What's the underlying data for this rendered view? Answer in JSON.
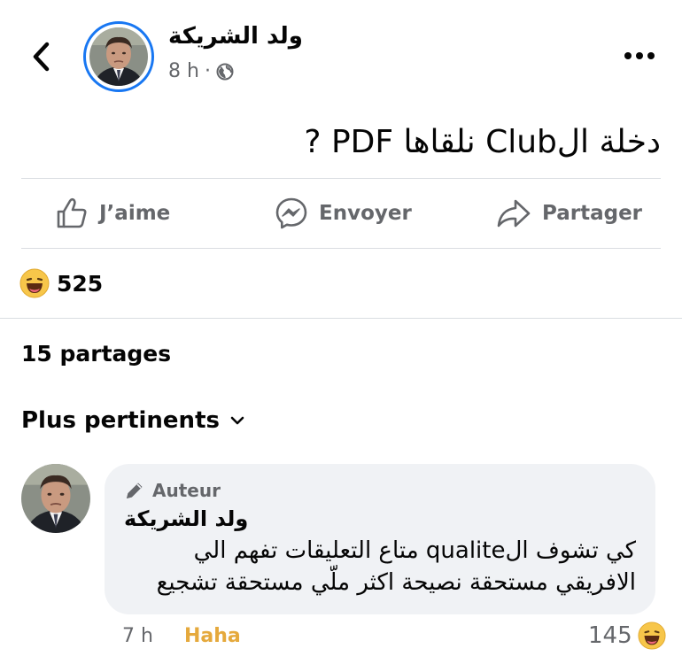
{
  "post": {
    "page_name": "ولد الشريكة",
    "time": "8 h",
    "separator": "·",
    "privacy_icon": "globe-icon",
    "text": "دخلة الClub نلقاها PDF ?"
  },
  "actions": {
    "like_label": "J’aime",
    "send_label": "Envoyer",
    "share_label": "Partager"
  },
  "reactions": {
    "emoji": "haha",
    "count": "525"
  },
  "shares": {
    "label": "15 partages"
  },
  "sort": {
    "label": "Plus pertinents"
  },
  "comment": {
    "badge_label": "Auteur",
    "author": "ولد الشريكة",
    "text": "كي تشوف الqualite متاع التعليقات تفهم الي الافريقي مستحقة نصيحة اكثر ملّي مستحقة تشجيع",
    "time": "7 h",
    "reaction_label": "Haha",
    "reaction_count": "145"
  },
  "colors": {
    "accent": "#1877f2",
    "muted": "#65676b",
    "haha": "#e5a93c",
    "bubble": "#f0f2f5"
  }
}
